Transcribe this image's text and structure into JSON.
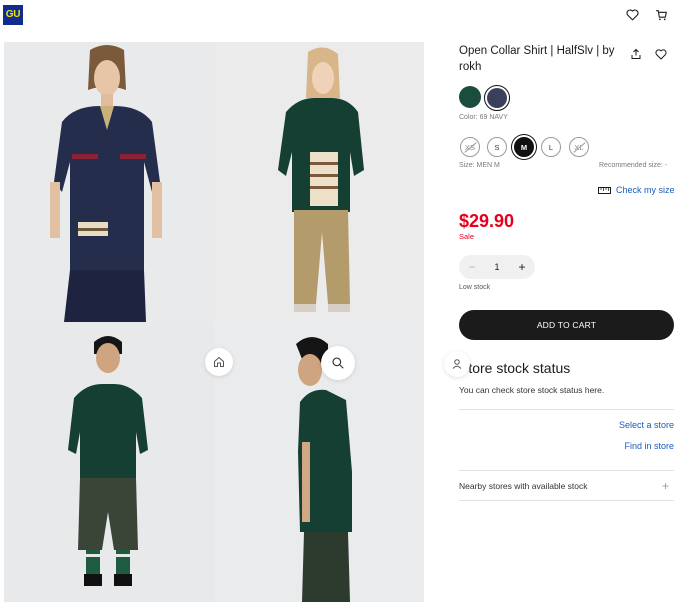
{
  "brand": {
    "logo_text": "GU",
    "logo_bg": "#102c8f",
    "logo_fg": "#f4e400"
  },
  "header": {
    "icons": [
      "heart-icon",
      "cart-icon"
    ]
  },
  "product": {
    "title": "Open Collar Shirt | HalfSlv | by rokh",
    "colors": [
      {
        "name": "green",
        "hex": "#1b4d3e",
        "selected": false
      },
      {
        "name": "navy",
        "hex": "#3a3f5c",
        "selected": true
      }
    ],
    "color_label": "Color: 69 NAVY",
    "sizes": [
      {
        "label": "XS",
        "available": false,
        "selected": false
      },
      {
        "label": "S",
        "available": true,
        "selected": false
      },
      {
        "label": "M",
        "available": true,
        "selected": true
      },
      {
        "label": "L",
        "available": true,
        "selected": false
      },
      {
        "label": "XL",
        "available": false,
        "selected": false
      }
    ],
    "size_label": "Size: MEN M",
    "recommended_label": "Recommended size: -",
    "check_size_label": "Check my size",
    "price": "$29.90",
    "sale_label": "Sale",
    "quantity": {
      "minus": "−",
      "value": "1",
      "plus": "+"
    },
    "stock_label": "Low stock",
    "add_to_cart_label": "ADD TO CART"
  },
  "store": {
    "heading": "Store stock status",
    "description": "You can check store stock status here.",
    "select_store_label": "Select a store",
    "find_store_label": "Find in store",
    "nearby_label": "Nearby stores with available stock",
    "nearby_plus": "+"
  },
  "gallery": {
    "images": [
      "model-front-navy",
      "model-front-green-khaki",
      "model-front-green-shorts",
      "model-side-green"
    ],
    "home_icon": "home-icon",
    "zoom_icon": "zoom-icon",
    "account_icon": "user-icon"
  }
}
